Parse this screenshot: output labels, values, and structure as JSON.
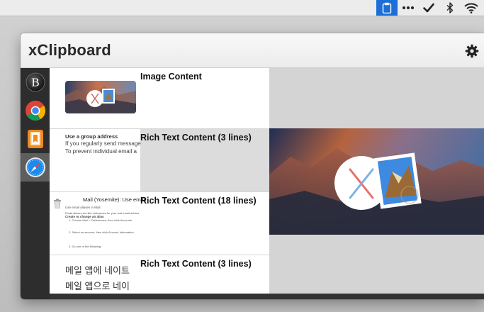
{
  "app": {
    "title": "xClipboard"
  },
  "sidebar": {
    "items": [
      {
        "name": "bbedit",
        "letter": "B"
      },
      {
        "name": "chrome"
      },
      {
        "name": "ibooks"
      },
      {
        "name": "safari"
      }
    ]
  },
  "clips": [
    {
      "title": "Image Content"
    },
    {
      "title": "Rich Text Content (3 lines)",
      "lines": [
        "Use a group address",
        "If you regularly send message",
        "To prevent individual email a"
      ]
    },
    {
      "title": "Rich Text Content (18 lines)",
      "heading": "Mail (Yosemite): Use email",
      "body": [
        "Use email aliases in Mail",
        "Email aliases are like nicknames for your real email addres",
        "Create or change an alias",
        "1.   Choose Mail > Preferences, then click Accounts.",
        "2.   Select an account, then click Account Information.",
        "3.   Do one of the following:"
      ]
    },
    {
      "title": "Rich Text Content (3 lines)",
      "lines": [
        "메일 앱에 네이트",
        "메일 앱으로 네이"
      ]
    }
  ],
  "colors": {
    "accent": "#1b6fd6",
    "sidebar_bg": "#2d2d2d",
    "selected_sidebar": "#5e5e5e"
  }
}
